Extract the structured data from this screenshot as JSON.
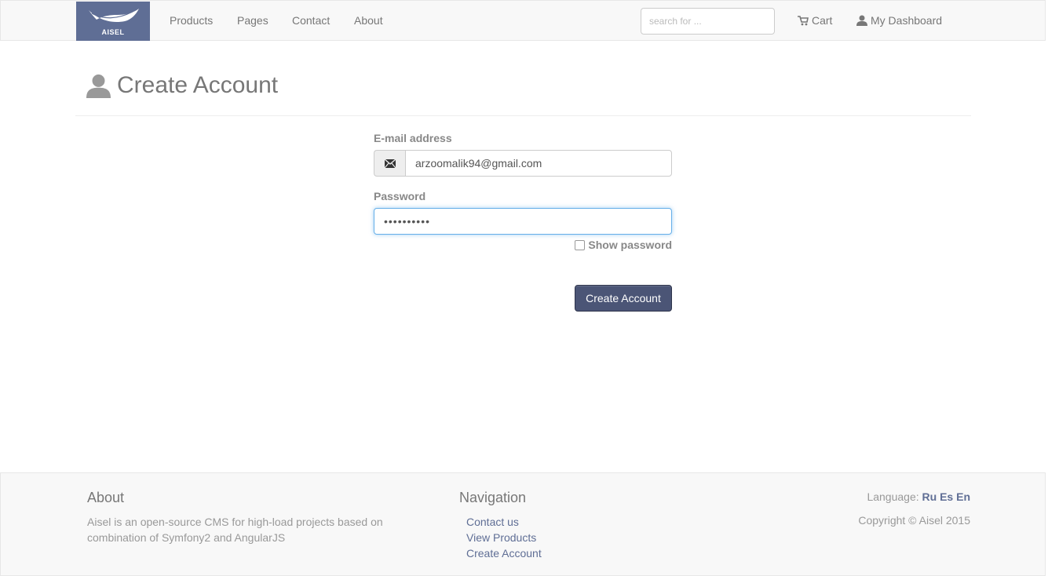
{
  "brand": {
    "name": "AISEL",
    "color": "#5f6e95"
  },
  "nav": {
    "items": [
      "Products",
      "Pages",
      "Contact",
      "About"
    ],
    "search_placeholder": "search for ...",
    "cart_label": "Cart",
    "dashboard_label": "My Dashboard"
  },
  "page": {
    "title": "Create Account",
    "icon": "user-icon"
  },
  "form": {
    "email_label": "E-mail address",
    "email_value": "arzoomalik94@gmail.com",
    "email_icon": "envelope-icon",
    "password_label": "Password",
    "password_value": "••••••••••",
    "show_password_label": "Show password",
    "submit_label": "Create Account",
    "button_color": "#4b5576"
  },
  "footer": {
    "about_heading": "About",
    "about_text": "Aisel is an open-source CMS for high-load projects based on combination of Symfony2 and AngularJS",
    "nav_heading": "Navigation",
    "nav_links": [
      "Contact us",
      "View Products",
      "Create Account"
    ],
    "language_label": "Language:",
    "languages": [
      "Ru",
      "Es",
      "En"
    ],
    "copyright": "Copyright © Aisel 2015"
  }
}
